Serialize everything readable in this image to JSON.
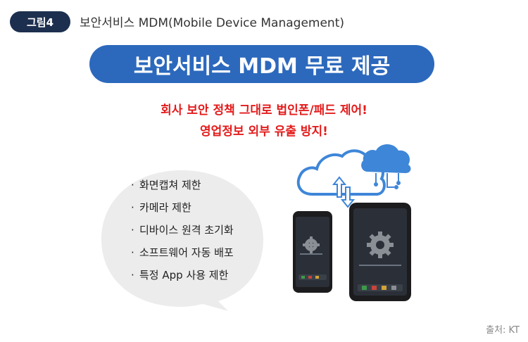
{
  "figure": {
    "badge": "그림4",
    "caption": "보안서비스 MDM(Mobile Device Management)"
  },
  "title": "보안서비스 MDM 무료 제공",
  "highlight": {
    "line1": "회사 보안 정책 그대로 법인폰/패드 제어!",
    "line2": "영업정보 외부 유출 방지!"
  },
  "features": [
    "화면캡쳐 제한",
    "카메라 제한",
    "디바이스 원격 초기화",
    "소프트웨어 자동 배포",
    "특정 App 사용 제한"
  ],
  "bullet": "·",
  "source": "출처: KT",
  "colors": {
    "badge_bg": "#1d2f4f",
    "banner_bg": "#2c69bd",
    "highlight_text": "#e31b1b",
    "bubble_bg": "#ececec",
    "cloud_blue": "#3e86d8"
  },
  "icons": [
    "cloud-sync-icon",
    "smartphone-icon",
    "tablet-icon",
    "gear-icon"
  ]
}
